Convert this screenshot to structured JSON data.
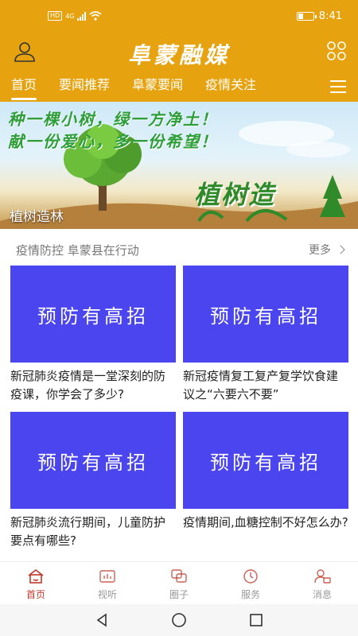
{
  "status_bar": {
    "network_tag": "HD",
    "network_type": "4G",
    "time": "8:41",
    "battery_level": 0.3
  },
  "header": {
    "title": "阜蒙融媒"
  },
  "tabs": [
    {
      "label": "首页",
      "active": true
    },
    {
      "label": "要闻推荐",
      "active": false
    },
    {
      "label": "阜蒙要闻",
      "active": false
    },
    {
      "label": "疫情关注",
      "active": false
    }
  ],
  "banner": {
    "slogan_line1": "种一棵小树，绿一方净土！",
    "slogan_line2": "献一份爱心，多一份希望！",
    "deco_text": "植树造",
    "caption": "植树造林"
  },
  "section": {
    "title": "疫情防控  阜蒙县在行动",
    "more_label": "更多"
  },
  "cards": [
    {
      "thumb_text": "预防有高招",
      "title": "新冠肺炎疫情是一堂深刻的防疫课，你学会了多少?"
    },
    {
      "thumb_text": "预防有高招",
      "title": "新冠疫情复工复产复学饮食建议之“六要六不要”"
    },
    {
      "thumb_text": "预防有高招",
      "title": "新冠肺炎流行期间，儿童防护要点有哪些?"
    },
    {
      "thumb_text": "预防有高招",
      "title": "疫情期间,血糖控制不好怎么办?"
    }
  ],
  "bottom_nav": [
    {
      "label": "首页",
      "icon": "home-icon",
      "active": true
    },
    {
      "label": "视听",
      "icon": "video-icon",
      "active": false
    },
    {
      "label": "圈子",
      "icon": "circle-icon",
      "active": false
    },
    {
      "label": "服务",
      "icon": "clock-icon",
      "active": false
    },
    {
      "label": "消息",
      "icon": "message-user-icon",
      "active": false
    }
  ],
  "colors": {
    "brand": "#e6a30f",
    "card_bg": "#4b45ef",
    "nav_active": "#c0392b"
  }
}
